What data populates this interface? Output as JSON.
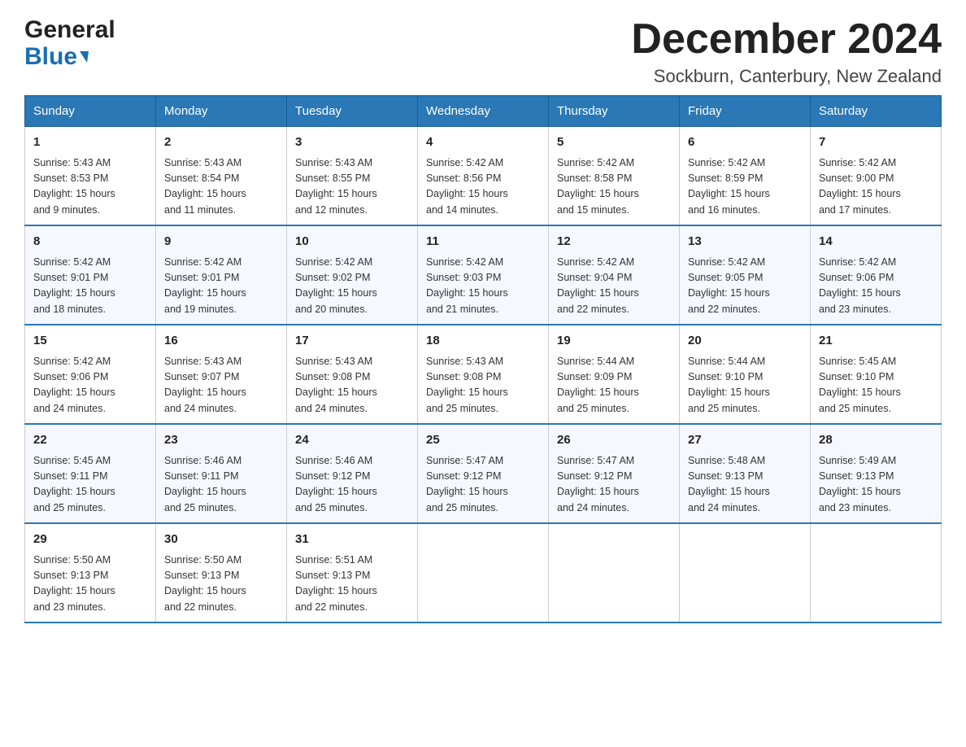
{
  "logo": {
    "general": "General",
    "blue": "Blue"
  },
  "title": {
    "month": "December 2024",
    "location": "Sockburn, Canterbury, New Zealand"
  },
  "weekdays": [
    "Sunday",
    "Monday",
    "Tuesday",
    "Wednesday",
    "Thursday",
    "Friday",
    "Saturday"
  ],
  "weeks": [
    [
      {
        "day": "1",
        "sunrise": "5:43 AM",
        "sunset": "8:53 PM",
        "daylight": "15 hours and 9 minutes."
      },
      {
        "day": "2",
        "sunrise": "5:43 AM",
        "sunset": "8:54 PM",
        "daylight": "15 hours and 11 minutes."
      },
      {
        "day": "3",
        "sunrise": "5:43 AM",
        "sunset": "8:55 PM",
        "daylight": "15 hours and 12 minutes."
      },
      {
        "day": "4",
        "sunrise": "5:42 AM",
        "sunset": "8:56 PM",
        "daylight": "15 hours and 14 minutes."
      },
      {
        "day": "5",
        "sunrise": "5:42 AM",
        "sunset": "8:58 PM",
        "daylight": "15 hours and 15 minutes."
      },
      {
        "day": "6",
        "sunrise": "5:42 AM",
        "sunset": "8:59 PM",
        "daylight": "15 hours and 16 minutes."
      },
      {
        "day": "7",
        "sunrise": "5:42 AM",
        "sunset": "9:00 PM",
        "daylight": "15 hours and 17 minutes."
      }
    ],
    [
      {
        "day": "8",
        "sunrise": "5:42 AM",
        "sunset": "9:01 PM",
        "daylight": "15 hours and 18 minutes."
      },
      {
        "day": "9",
        "sunrise": "5:42 AM",
        "sunset": "9:01 PM",
        "daylight": "15 hours and 19 minutes."
      },
      {
        "day": "10",
        "sunrise": "5:42 AM",
        "sunset": "9:02 PM",
        "daylight": "15 hours and 20 minutes."
      },
      {
        "day": "11",
        "sunrise": "5:42 AM",
        "sunset": "9:03 PM",
        "daylight": "15 hours and 21 minutes."
      },
      {
        "day": "12",
        "sunrise": "5:42 AM",
        "sunset": "9:04 PM",
        "daylight": "15 hours and 22 minutes."
      },
      {
        "day": "13",
        "sunrise": "5:42 AM",
        "sunset": "9:05 PM",
        "daylight": "15 hours and 22 minutes."
      },
      {
        "day": "14",
        "sunrise": "5:42 AM",
        "sunset": "9:06 PM",
        "daylight": "15 hours and 23 minutes."
      }
    ],
    [
      {
        "day": "15",
        "sunrise": "5:42 AM",
        "sunset": "9:06 PM",
        "daylight": "15 hours and 24 minutes."
      },
      {
        "day": "16",
        "sunrise": "5:43 AM",
        "sunset": "9:07 PM",
        "daylight": "15 hours and 24 minutes."
      },
      {
        "day": "17",
        "sunrise": "5:43 AM",
        "sunset": "9:08 PM",
        "daylight": "15 hours and 24 minutes."
      },
      {
        "day": "18",
        "sunrise": "5:43 AM",
        "sunset": "9:08 PM",
        "daylight": "15 hours and 25 minutes."
      },
      {
        "day": "19",
        "sunrise": "5:44 AM",
        "sunset": "9:09 PM",
        "daylight": "15 hours and 25 minutes."
      },
      {
        "day": "20",
        "sunrise": "5:44 AM",
        "sunset": "9:10 PM",
        "daylight": "15 hours and 25 minutes."
      },
      {
        "day": "21",
        "sunrise": "5:45 AM",
        "sunset": "9:10 PM",
        "daylight": "15 hours and 25 minutes."
      }
    ],
    [
      {
        "day": "22",
        "sunrise": "5:45 AM",
        "sunset": "9:11 PM",
        "daylight": "15 hours and 25 minutes."
      },
      {
        "day": "23",
        "sunrise": "5:46 AM",
        "sunset": "9:11 PM",
        "daylight": "15 hours and 25 minutes."
      },
      {
        "day": "24",
        "sunrise": "5:46 AM",
        "sunset": "9:12 PM",
        "daylight": "15 hours and 25 minutes."
      },
      {
        "day": "25",
        "sunrise": "5:47 AM",
        "sunset": "9:12 PM",
        "daylight": "15 hours and 25 minutes."
      },
      {
        "day": "26",
        "sunrise": "5:47 AM",
        "sunset": "9:12 PM",
        "daylight": "15 hours and 24 minutes."
      },
      {
        "day": "27",
        "sunrise": "5:48 AM",
        "sunset": "9:13 PM",
        "daylight": "15 hours and 24 minutes."
      },
      {
        "day": "28",
        "sunrise": "5:49 AM",
        "sunset": "9:13 PM",
        "daylight": "15 hours and 23 minutes."
      }
    ],
    [
      {
        "day": "29",
        "sunrise": "5:50 AM",
        "sunset": "9:13 PM",
        "daylight": "15 hours and 23 minutes."
      },
      {
        "day": "30",
        "sunrise": "5:50 AM",
        "sunset": "9:13 PM",
        "daylight": "15 hours and 22 minutes."
      },
      {
        "day": "31",
        "sunrise": "5:51 AM",
        "sunset": "9:13 PM",
        "daylight": "15 hours and 22 minutes."
      },
      null,
      null,
      null,
      null
    ]
  ],
  "labels": {
    "sunrise": "Sunrise:",
    "sunset": "Sunset:",
    "daylight": "Daylight: 15 hours"
  }
}
